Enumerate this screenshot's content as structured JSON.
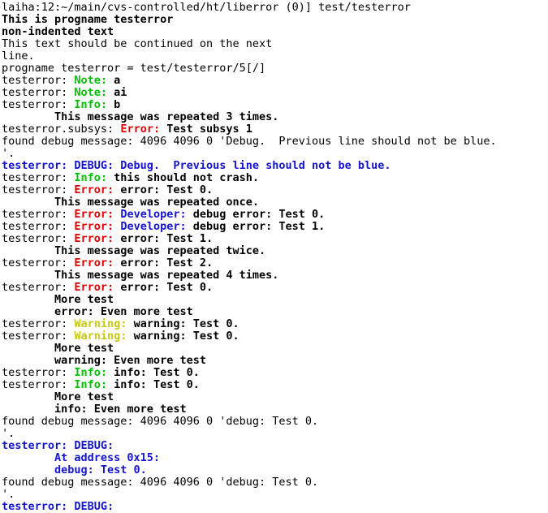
{
  "terminal": {
    "window_title": "terminal",
    "prompt_line": "laiha:12:~/main/cvs-controlled/ht/liberror (0)] test/testerror",
    "colors": {
      "background": "#ffffff",
      "default_text": "#000000",
      "note_green": "#00c000",
      "error_red": "#e00000",
      "debug_blue": "#1414cc",
      "warning_yellow": "#c8c814"
    },
    "lines": [
      {
        "id": "line-0",
        "segments": [
          {
            "text": "laiha:12:~/main/cvs-controlled/ht/liberror (0)] test/testerror",
            "color": "default",
            "bold": false
          }
        ]
      },
      {
        "id": "line-1",
        "segments": [
          {
            "text": "This is progname testerror",
            "color": "default",
            "bold": true
          }
        ]
      },
      {
        "id": "line-2",
        "segments": [
          {
            "text": "non-indented text",
            "color": "default",
            "bold": true
          }
        ]
      },
      {
        "id": "line-3",
        "segments": [
          {
            "text": "This text should be continued on the next",
            "color": "default",
            "bold": false
          }
        ]
      },
      {
        "id": "line-4",
        "segments": [
          {
            "text": "line.",
            "color": "default",
            "bold": false
          }
        ]
      },
      {
        "id": "line-5",
        "segments": [
          {
            "text": "progname testerror = test/testerror/5[/]",
            "color": "default",
            "bold": false
          }
        ]
      },
      {
        "id": "line-6",
        "segments": [
          {
            "text": "testerror: ",
            "color": "default",
            "bold": false
          },
          {
            "text": "Note:",
            "color": "green",
            "bold": true
          },
          {
            "text": " a",
            "color": "default",
            "bold": true
          }
        ]
      },
      {
        "id": "line-7",
        "segments": [
          {
            "text": "testerror: ",
            "color": "default",
            "bold": false
          },
          {
            "text": "Note:",
            "color": "green",
            "bold": true
          },
          {
            "text": " ai",
            "color": "default",
            "bold": true
          }
        ]
      },
      {
        "id": "line-8",
        "segments": [
          {
            "text": "testerror: ",
            "color": "default",
            "bold": false
          },
          {
            "text": "Info:",
            "color": "green",
            "bold": true
          },
          {
            "text": " b",
            "color": "default",
            "bold": true
          }
        ]
      },
      {
        "id": "line-9",
        "segments": [
          {
            "text": "        This message was repeated 3 times.",
            "color": "default",
            "bold": true
          }
        ]
      },
      {
        "id": "line-10",
        "segments": [
          {
            "text": "testerror.subsys: ",
            "color": "default",
            "bold": false
          },
          {
            "text": "Error:",
            "color": "red",
            "bold": true
          },
          {
            "text": " Test subsys 1",
            "color": "default",
            "bold": true
          }
        ]
      },
      {
        "id": "line-11",
        "segments": [
          {
            "text": "found debug message: 4096 4096 0 'Debug.  Previous line should not be blue.",
            "color": "default",
            "bold": false
          }
        ]
      },
      {
        "id": "line-12",
        "segments": [
          {
            "text": "'.",
            "color": "default",
            "bold": false
          }
        ]
      },
      {
        "id": "line-13",
        "segments": [
          {
            "text": "testerror: DEBUG: Debug.  Previous line should not be blue.",
            "color": "blue",
            "bold": true
          }
        ]
      },
      {
        "id": "line-14",
        "segments": [
          {
            "text": "testerror: ",
            "color": "default",
            "bold": false
          },
          {
            "text": "Info:",
            "color": "green",
            "bold": true
          },
          {
            "text": " this should not crash.",
            "color": "default",
            "bold": true
          }
        ]
      },
      {
        "id": "line-15",
        "segments": [
          {
            "text": "testerror: ",
            "color": "default",
            "bold": false
          },
          {
            "text": "Error:",
            "color": "red",
            "bold": true
          },
          {
            "text": " error: Test 0.",
            "color": "default",
            "bold": true
          }
        ]
      },
      {
        "id": "line-16",
        "segments": [
          {
            "text": "        This message was repeated once.",
            "color": "default",
            "bold": true
          }
        ]
      },
      {
        "id": "line-17",
        "segments": [
          {
            "text": "testerror: ",
            "color": "default",
            "bold": false
          },
          {
            "text": "Error:",
            "color": "red",
            "bold": true
          },
          {
            "text": " ",
            "color": "default",
            "bold": true
          },
          {
            "text": "Developer:",
            "color": "blue",
            "bold": true
          },
          {
            "text": " debug error: Test 0.",
            "color": "default",
            "bold": true
          }
        ]
      },
      {
        "id": "line-18",
        "segments": [
          {
            "text": "testerror: ",
            "color": "default",
            "bold": false
          },
          {
            "text": "Error:",
            "color": "red",
            "bold": true
          },
          {
            "text": " ",
            "color": "default",
            "bold": true
          },
          {
            "text": "Developer:",
            "color": "blue",
            "bold": true
          },
          {
            "text": " debug error: Test 1.",
            "color": "default",
            "bold": true
          }
        ]
      },
      {
        "id": "line-19",
        "segments": [
          {
            "text": "testerror: ",
            "color": "default",
            "bold": false
          },
          {
            "text": "Error:",
            "color": "red",
            "bold": true
          },
          {
            "text": " error: Test 1.",
            "color": "default",
            "bold": true
          }
        ]
      },
      {
        "id": "line-20",
        "segments": [
          {
            "text": "        This message was repeated twice.",
            "color": "default",
            "bold": true
          }
        ]
      },
      {
        "id": "line-21",
        "segments": [
          {
            "text": "testerror: ",
            "color": "default",
            "bold": false
          },
          {
            "text": "Error:",
            "color": "red",
            "bold": true
          },
          {
            "text": " error: Test 2.",
            "color": "default",
            "bold": true
          }
        ]
      },
      {
        "id": "line-22",
        "segments": [
          {
            "text": "        This message was repeated 4 times.",
            "color": "default",
            "bold": true
          }
        ]
      },
      {
        "id": "line-23",
        "segments": [
          {
            "text": "testerror: ",
            "color": "default",
            "bold": false
          },
          {
            "text": "Error:",
            "color": "red",
            "bold": true
          },
          {
            "text": " error: Test 0.",
            "color": "default",
            "bold": true
          }
        ]
      },
      {
        "id": "line-24",
        "segments": [
          {
            "text": "        More test",
            "color": "default",
            "bold": true
          }
        ]
      },
      {
        "id": "line-25",
        "segments": [
          {
            "text": "        error: Even more test",
            "color": "default",
            "bold": true
          }
        ]
      },
      {
        "id": "line-26",
        "segments": [
          {
            "text": "testerror: ",
            "color": "default",
            "bold": false
          },
          {
            "text": "Warning:",
            "color": "yellow",
            "bold": true
          },
          {
            "text": " warning: Test 0.",
            "color": "default",
            "bold": true
          }
        ]
      },
      {
        "id": "line-27",
        "segments": [
          {
            "text": "testerror: ",
            "color": "default",
            "bold": false
          },
          {
            "text": "Warning:",
            "color": "yellow",
            "bold": true
          },
          {
            "text": " warning: Test 0.",
            "color": "default",
            "bold": true
          }
        ]
      },
      {
        "id": "line-28",
        "segments": [
          {
            "text": "        More test",
            "color": "default",
            "bold": true
          }
        ]
      },
      {
        "id": "line-29",
        "segments": [
          {
            "text": "        warning: Even more test",
            "color": "default",
            "bold": true
          }
        ]
      },
      {
        "id": "line-30",
        "segments": [
          {
            "text": "testerror: ",
            "color": "default",
            "bold": false
          },
          {
            "text": "Info:",
            "color": "green",
            "bold": true
          },
          {
            "text": " info: Test 0.",
            "color": "default",
            "bold": true
          }
        ]
      },
      {
        "id": "line-31",
        "segments": [
          {
            "text": "testerror: ",
            "color": "default",
            "bold": false
          },
          {
            "text": "Info:",
            "color": "green",
            "bold": true
          },
          {
            "text": " info: Test 0.",
            "color": "default",
            "bold": true
          }
        ]
      },
      {
        "id": "line-32",
        "segments": [
          {
            "text": "        More test",
            "color": "default",
            "bold": true
          }
        ]
      },
      {
        "id": "line-33",
        "segments": [
          {
            "text": "        info: Even more test",
            "color": "default",
            "bold": true
          }
        ]
      },
      {
        "id": "line-34",
        "segments": [
          {
            "text": "found debug message: 4096 4096 0 'debug: Test 0.",
            "color": "default",
            "bold": false
          }
        ]
      },
      {
        "id": "line-35",
        "segments": [
          {
            "text": "'.",
            "color": "default",
            "bold": false
          }
        ]
      },
      {
        "id": "line-36",
        "segments": [
          {
            "text": "testerror: DEBUG:",
            "color": "blue",
            "bold": true
          }
        ]
      },
      {
        "id": "line-37",
        "segments": [
          {
            "text": "        At address 0x15:",
            "color": "blue",
            "bold": true
          }
        ]
      },
      {
        "id": "line-38",
        "segments": [
          {
            "text": "        debug: Test 0.",
            "color": "blue",
            "bold": true
          }
        ]
      },
      {
        "id": "line-39",
        "segments": [
          {
            "text": "found debug message: 4096 4096 0 'debug: Test 0.",
            "color": "default",
            "bold": false
          }
        ]
      },
      {
        "id": "line-40",
        "segments": [
          {
            "text": "'.",
            "color": "default",
            "bold": false
          }
        ]
      },
      {
        "id": "line-41",
        "segments": [
          {
            "text": "testerror: DEBUG:",
            "color": "blue",
            "bold": true
          }
        ]
      }
    ]
  }
}
